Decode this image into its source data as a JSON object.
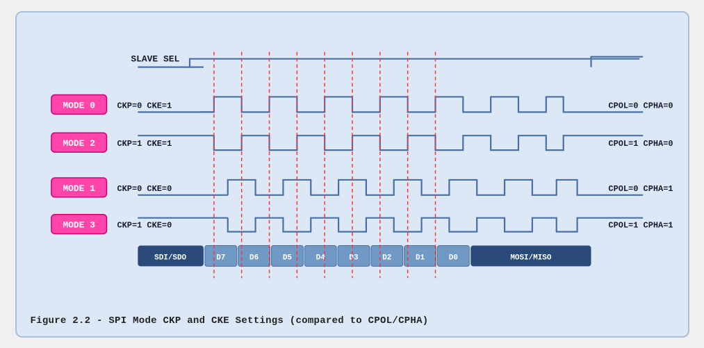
{
  "diagram": {
    "title": "Figure 2.2 - SPI Mode CKP and CKE Settings (compared to CPOL/CPHA)",
    "slave_sel_label": "SLAVE SEL",
    "modes": [
      {
        "label": "MODE 0",
        "params": "CKP=0  CKE=1",
        "right": "CPOL=0  CPHA=0"
      },
      {
        "label": "MODE 2",
        "params": "CKP=1  CKE=1",
        "right": "CPOL=1  CPHA=0"
      },
      {
        "label": "MODE 1",
        "params": "CKP=0  CKE=0",
        "right": "CPOL=0  CPHA=1"
      },
      {
        "label": "MODE 3",
        "params": "CKP=1  CKE=0",
        "right": "CPOL=1  CPHA=1"
      }
    ],
    "data_labels": [
      "SDI/SDO",
      "D7",
      "D6",
      "D5",
      "D4",
      "D3",
      "D2",
      "D1",
      "D0",
      "MOSI/MISO"
    ],
    "colors": {
      "mode_badge": "#ff44aa",
      "mode_badge_border": "#cc0077",
      "waveform": "#4a6fa5",
      "dashed_line": "#ff3333",
      "data_bar_bg": "#2a4a7a",
      "data_bit_bg": "#7099c5",
      "text_light": "#ffffff",
      "text_dark": "#1a1a2e"
    }
  }
}
